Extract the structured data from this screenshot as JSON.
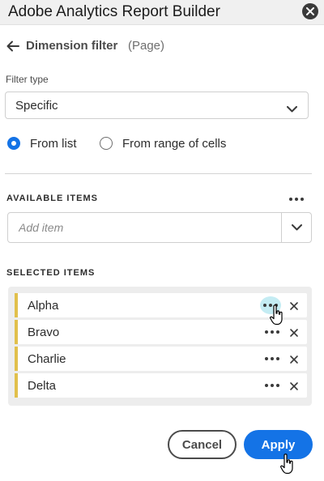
{
  "window": {
    "title": "Adobe Analytics Report Builder",
    "close_icon": "close-circle-icon"
  },
  "header": {
    "back_icon": "arrow-left-icon",
    "title": "Dimension filter",
    "subtitle": "(Page)"
  },
  "filter_type": {
    "label": "Filter type",
    "value": "Specific"
  },
  "source_options": [
    {
      "label": "From list",
      "selected": true
    },
    {
      "label": "From range of cells",
      "selected": false
    }
  ],
  "available_items": {
    "heading": "AVAILABLE ITEMS",
    "placeholder": "Add item",
    "value": ""
  },
  "selected_items": {
    "heading": "SELECTED ITEMS",
    "items": [
      {
        "label": "Alpha",
        "more_hovered": true
      },
      {
        "label": "Bravo",
        "more_hovered": false
      },
      {
        "label": "Charlie",
        "more_hovered": false
      },
      {
        "label": "Delta",
        "more_hovered": false
      }
    ]
  },
  "footer": {
    "cancel_label": "Cancel",
    "apply_label": "Apply"
  },
  "colors": {
    "accent": "#1473e6",
    "item_marker": "#e1c04c",
    "hover_highlight": "#c4ecf3"
  }
}
